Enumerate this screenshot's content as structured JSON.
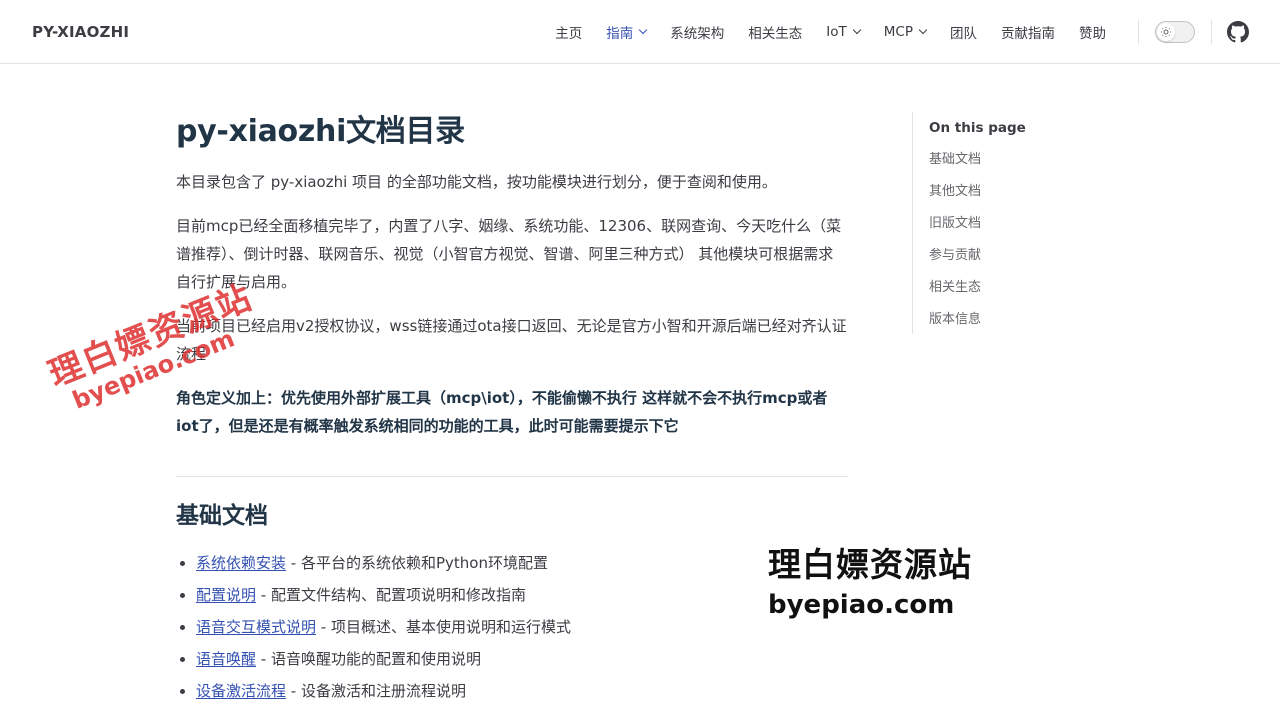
{
  "brand": "PY-XIAOZHI",
  "nav": {
    "items": [
      {
        "label": "主页",
        "active": false,
        "dropdown": false
      },
      {
        "label": "指南",
        "active": true,
        "dropdown": true
      },
      {
        "label": "系统架构",
        "active": false,
        "dropdown": false
      },
      {
        "label": "相关生态",
        "active": false,
        "dropdown": false
      },
      {
        "label": "IoT",
        "active": false,
        "dropdown": true
      },
      {
        "label": "MCP",
        "active": false,
        "dropdown": true
      },
      {
        "label": "团队",
        "active": false,
        "dropdown": false
      },
      {
        "label": "贡献指南",
        "active": false,
        "dropdown": false
      },
      {
        "label": "赞助",
        "active": false,
        "dropdown": false
      }
    ],
    "theme_toggle_icon": "sun-icon",
    "github_icon": "github-icon"
  },
  "main": {
    "title": "py-xiaozhi文档目录",
    "paragraphs": [
      "本目录包含了 py-xiaozhi 项目 的全部功能文档，按功能模块进行划分，便于查阅和使用。",
      "目前mcp已经全面移植完毕了，内置了八字、姻缘、系统功能、12306、联网查询、今天吃什么（菜谱推荐）、倒计时器、联网音乐、视觉（小智官方视觉、智谱、阿里三种方式） 其他模块可根据需求自行扩展与启用。",
      "当前项目已经启用v2授权协议，wss链接通过ota接口返回、无论是官方小智和开源后端已经对齐认证流程"
    ],
    "bold_paragraph": "角色定义加上：优先使用外部扩展工具（mcp\\iot），不能偷懒不执行 这样就不会不执行mcp或者iot了，但是还是有概率触发系统相同的功能的工具，此时可能需要提示下它",
    "section": {
      "heading": "基础文档",
      "items": [
        {
          "link": "系统依赖安装",
          "desc": " - 各平台的系统依赖和Python环境配置"
        },
        {
          "link": "配置说明",
          "desc": " - 配置文件结构、配置项说明和修改指南"
        },
        {
          "link": "语音交互模式说明",
          "desc": " - 项目概述、基本使用说明和运行模式"
        },
        {
          "link": "语音唤醒",
          "desc": " - 语音唤醒功能的配置和使用说明"
        },
        {
          "link": "设备激活流程",
          "desc": " - 设备激活和注册流程说明"
        }
      ]
    }
  },
  "aside": {
    "title": "On this page",
    "links": [
      "基础文档",
      "其他文档",
      "旧版文档",
      "参与贡献",
      "相关生态",
      "版本信息"
    ]
  },
  "watermark": {
    "cn": "理白嫖资源站",
    "en": "byepiao.com",
    "cn2": "理白嫖资源站",
    "en2": "byepiao.com"
  },
  "colors": {
    "accent": "#3451b2",
    "text": "#3c3c43",
    "heading": "#213547",
    "watermark_red": "#de3030"
  }
}
